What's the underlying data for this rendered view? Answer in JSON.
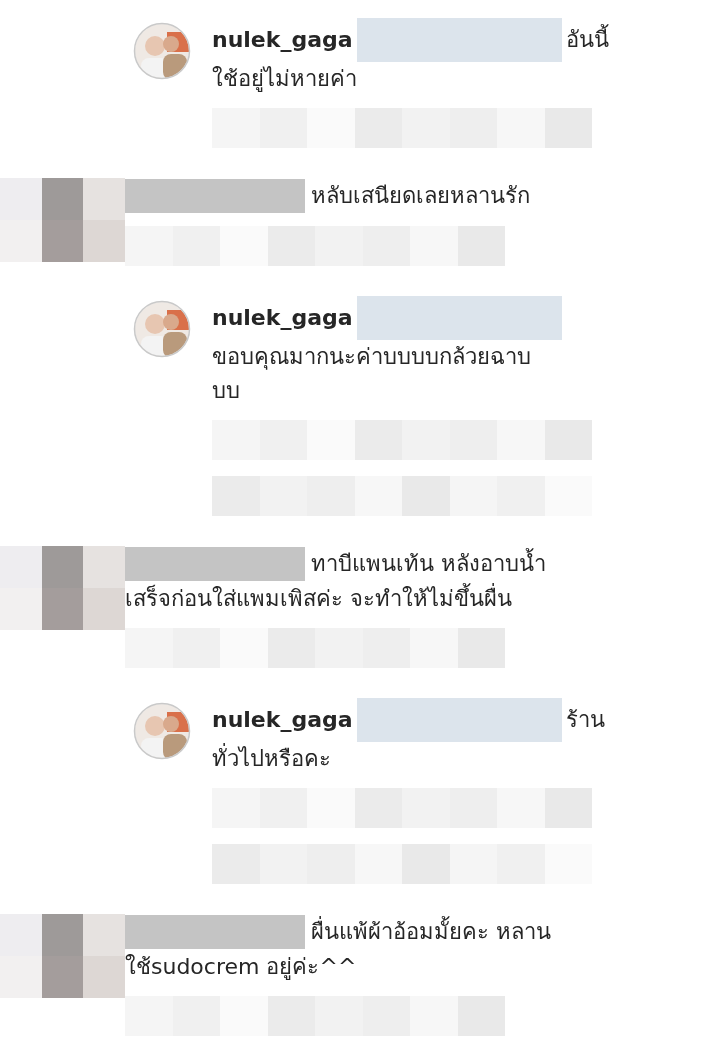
{
  "comments": [
    {
      "kind": "reply",
      "username": "nulek_gaga",
      "inline_text": "อันนี้",
      "lines": [
        "ใช้อยู่ไม่หายค่า"
      ],
      "meta": [
        {
          "kind": "pixelated"
        }
      ]
    },
    {
      "kind": "comment",
      "inline_text": "หลับเสนียดเลยหลานรัก",
      "meta": [
        {
          "kind": "pixelated"
        }
      ]
    },
    {
      "kind": "reply",
      "username": "nulek_gaga",
      "lines": [
        "ขอบคุณมากนะค่าบบบบกล้วยฉาบ",
        "บบ"
      ],
      "meta": [
        {
          "kind": "pixelated"
        },
        {
          "kind": "pixelated"
        }
      ]
    },
    {
      "kind": "comment",
      "inline_text": "ทาบีแพนเท้น หลังอาบน้ำ",
      "lines": [
        "เสร็จก่อนใส่แพมเพิสค่ะ จะทำให้ไม่ขึ้นผื่น"
      ],
      "meta": [
        {
          "kind": "pixelated"
        }
      ]
    },
    {
      "kind": "reply",
      "username": "nulek_gaga",
      "inline_text": "ร้าน",
      "lines": [
        "ทั่วไปหรือคะ"
      ],
      "meta": [
        {
          "kind": "pixelated"
        },
        {
          "kind": "pixelated"
        }
      ]
    },
    {
      "kind": "comment",
      "inline_text": "ผื่นแพ้ผ้าอ้อมมั้ยคะ หลาน",
      "lines": [
        "ใช้sudocrem อยู่ค่ะ^^"
      ],
      "meta": [
        {
          "kind": "pixelated"
        }
      ]
    }
  ]
}
